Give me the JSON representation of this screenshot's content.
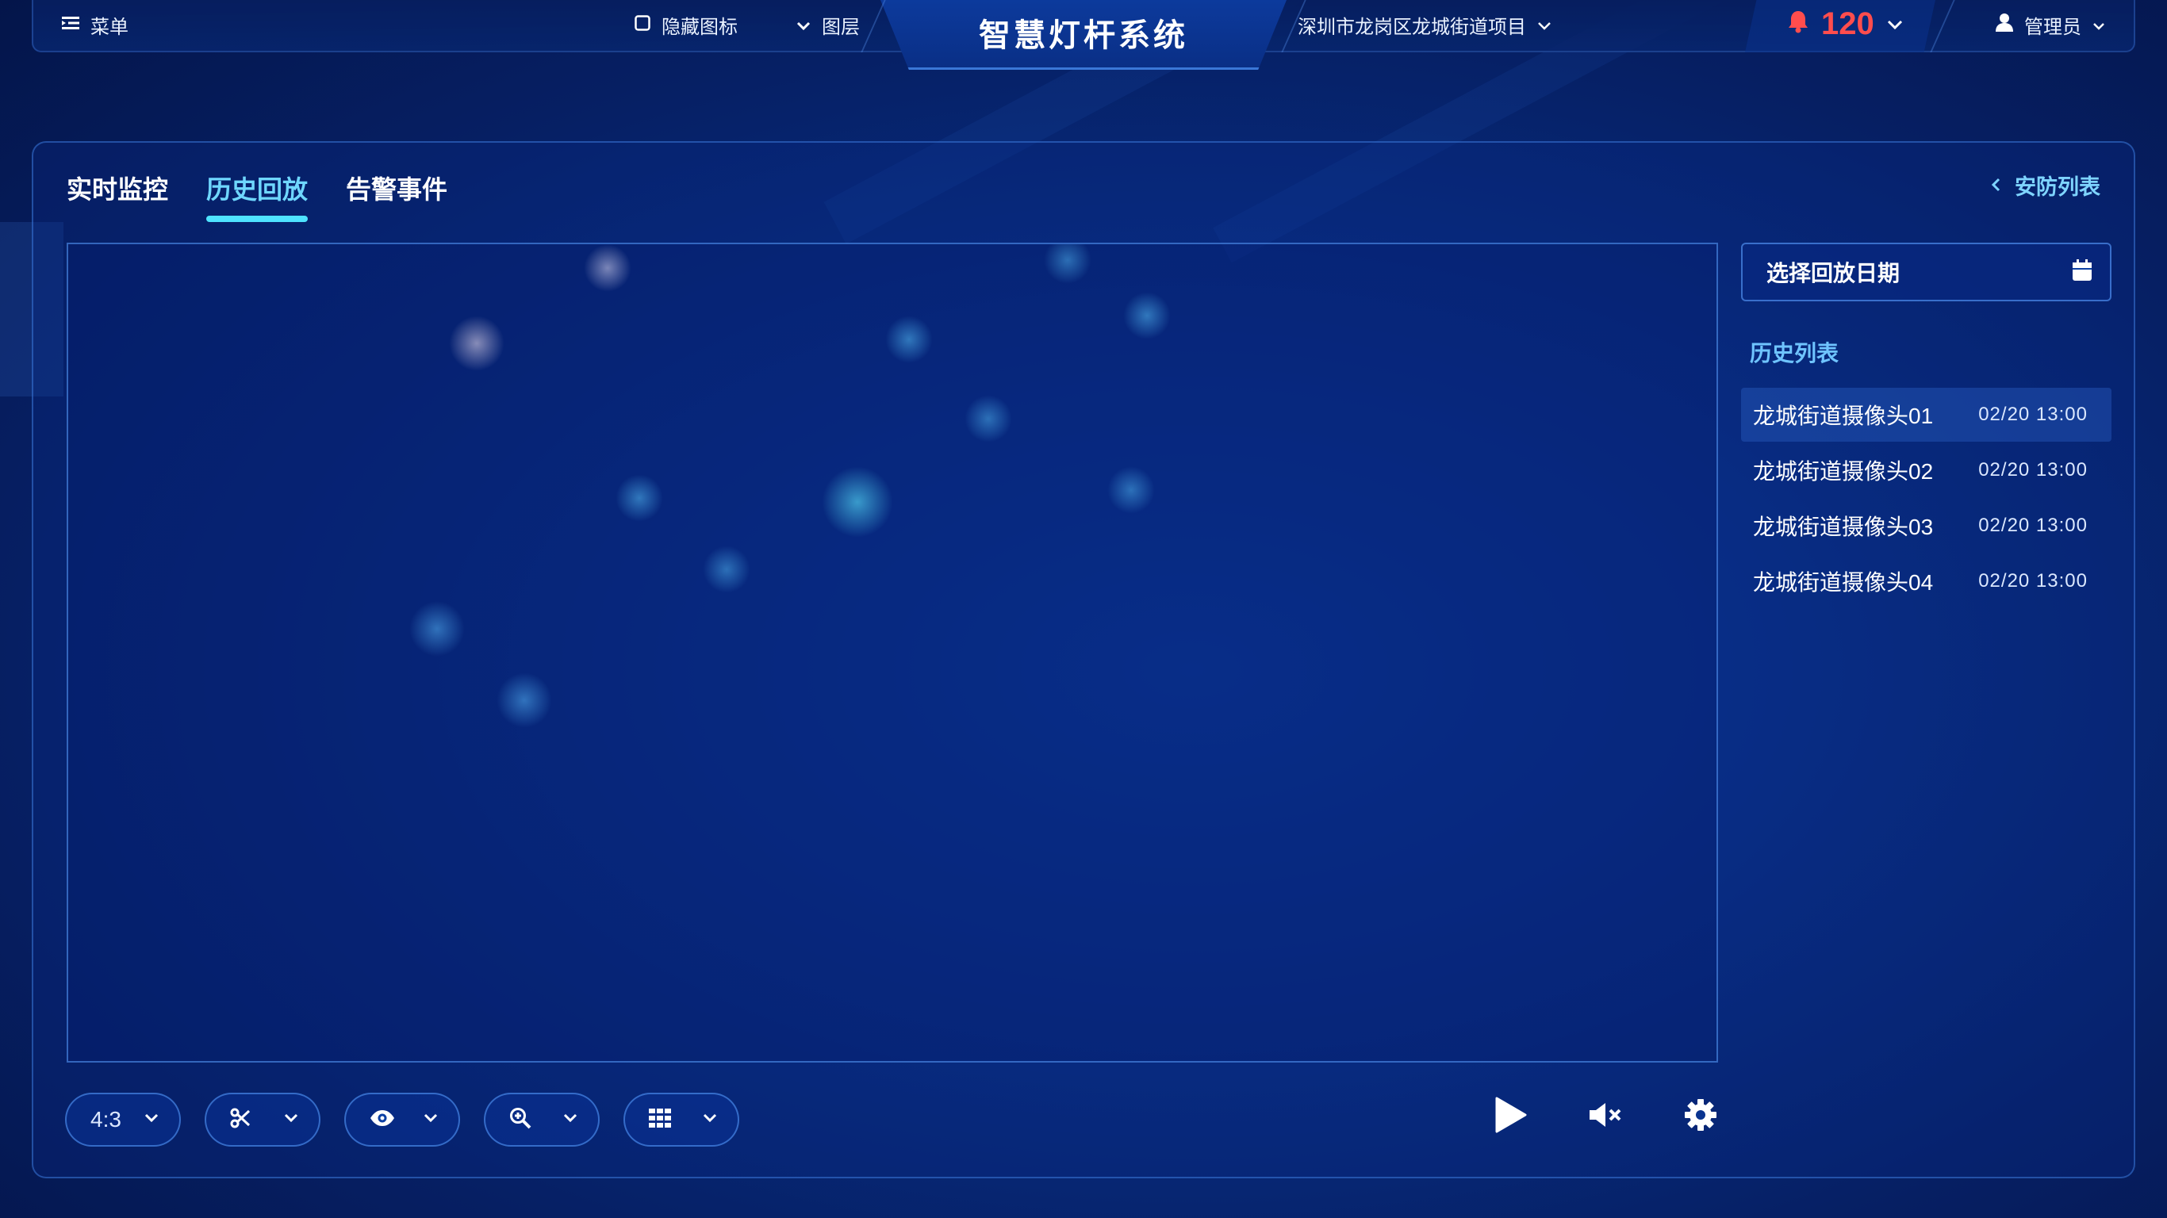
{
  "header": {
    "menu_label": "菜单",
    "hide_icons_label": "隐藏图标",
    "layers_label": "图层",
    "system_title": "智慧灯杆系统",
    "project_label": "深圳市龙岗区龙城街道项目",
    "alarm_count": "120",
    "user_label": "管理员"
  },
  "tabs": [
    {
      "label": "实时监控",
      "active": false
    },
    {
      "label": "历史回放",
      "active": true
    },
    {
      "label": "告警事件",
      "active": false
    }
  ],
  "side_panel": {
    "back_label": "安防列表",
    "date_placeholder": "选择回放日期",
    "history_title": "历史列表",
    "history": [
      {
        "name": "龙城街道摄像头01",
        "time": "02/20 13:00",
        "selected": true
      },
      {
        "name": "龙城街道摄像头02",
        "time": "02/20 13:00",
        "selected": false
      },
      {
        "name": "龙城街道摄像头03",
        "time": "02/20 13:00",
        "selected": false
      },
      {
        "name": "龙城街道摄像头04",
        "time": "02/20 13:00",
        "selected": false
      }
    ]
  },
  "controls": {
    "aspect_ratio": "4:3",
    "icons": [
      "scissors-icon",
      "eye-icon",
      "zoom-in-icon",
      "grid-icon",
      "play-icon",
      "mute-icon",
      "settings-icon"
    ]
  },
  "colors": {
    "accent": "#4ee3ff",
    "active_tab": "#6fd7ff",
    "alarm": "#ff4d4d",
    "background": "#082f86"
  }
}
